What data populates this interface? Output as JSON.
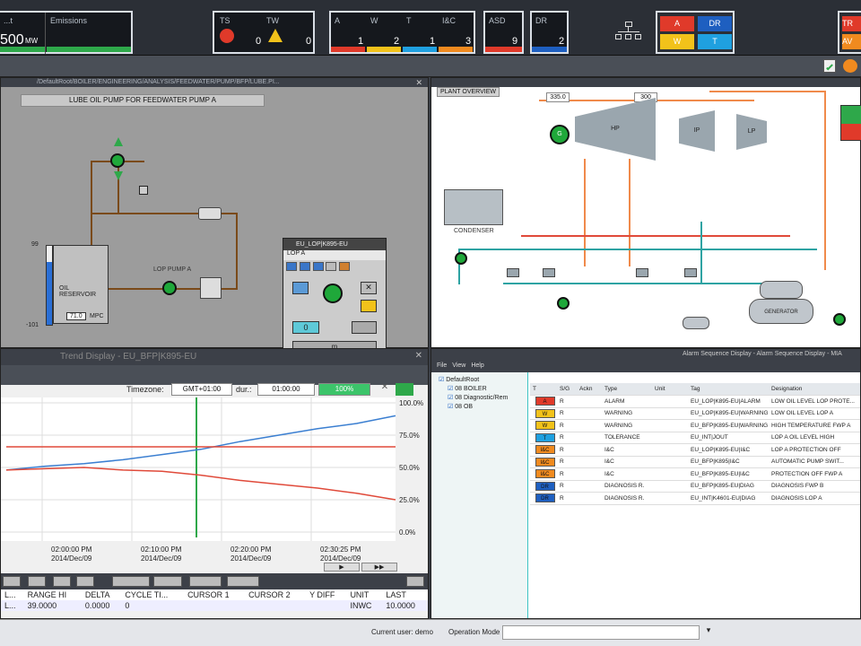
{
  "topbar": {
    "load": {
      "label": "...t",
      "value": "500",
      "unit": "MW"
    },
    "emissions": {
      "label": "Emissions"
    },
    "ts": {
      "label": "TS",
      "value": "0"
    },
    "tw": {
      "label": "TW",
      "value": "0"
    },
    "alarms": [
      {
        "label": "A",
        "value": "1",
        "color": "#e03a2a"
      },
      {
        "label": "W",
        "value": "2",
        "color": "#f2c21a"
      },
      {
        "label": "T",
        "value": "1",
        "color": "#1fa0e0"
      },
      {
        "label": "I&C",
        "value": "3",
        "color": "#f08a1f"
      }
    ],
    "asd": {
      "label": "ASD",
      "value": "9"
    },
    "dr": {
      "label": "DR",
      "value": "2"
    },
    "summary": [
      {
        "label": "A",
        "color": "#e03a2a"
      },
      {
        "label": "DR",
        "color": "#1e5fc0"
      },
      {
        "label": "W",
        "color": "#f2c21a"
      },
      {
        "label": "T",
        "color": "#1fa0e0"
      }
    ],
    "right": [
      {
        "label": "TR",
        "color": "#e03a2a"
      },
      {
        "label": "AV",
        "color": "#f08a1f"
      }
    ]
  },
  "lube": {
    "path": "/DefaultRoot/BOILER/ENGINEERING/ANALYSIS/FEEDWATER/PUMP/BFP/LUBE.PI...",
    "title": "LUBE OIL PUMP FOR FEEDWATER PUMP A",
    "tank_label": "OIL RESERVOIR",
    "tank_value": "71.0",
    "tank_unit": "MPC",
    "scale_top": "99",
    "scale_bottom": "-101",
    "pump_label": "LOP PUMP A",
    "faceplate": {
      "title": "EU_LOP|K895-EU",
      "subtitle": "LOP A",
      "value": "0",
      "button": "m"
    }
  },
  "plant": {
    "title": "PLANT OVERVIEW",
    "mw1": "335.0",
    "mw2": "300",
    "unit": "MW",
    "hp": "HP",
    "ip": "IP",
    "lp": "LP",
    "gen": "G",
    "condenser": "CONDENSER",
    "generator": "GENERATOR"
  },
  "trend": {
    "title": "Trend Display - EU_BFP|K895-EU",
    "timezone_label": "Timezone:",
    "timezone": "GMT+01:00",
    "dur_label": "dur.:",
    "dur": "01:00:00",
    "percent": "100%",
    "yaxis": [
      "100.0%",
      "75.0%",
      "50.0%",
      "25.0%",
      "0.0%"
    ],
    "xaxis": [
      {
        "t": "02:00:00 PM",
        "d": "2014/Dec/09"
      },
      {
        "t": "02:10:00 PM",
        "d": "2014/Dec/09"
      },
      {
        "t": "02:20:00 PM",
        "d": "2014/Dec/09"
      },
      {
        "t": "02:30:25 PM",
        "d": "2014/Dec/09"
      }
    ],
    "left_x": [
      "...0 PM",
      "...0"
    ],
    "table": {
      "headers": [
        "L...",
        "RANGE HI",
        "DELTA",
        "CYCLE TI...",
        "CURSOR 1",
        "CURSOR 2",
        "Y DIFF",
        "UNIT",
        "LAST"
      ],
      "values": [
        "L...",
        "39.0000",
        "0.0000",
        "0",
        "",
        "",
        "",
        "INWC",
        "10.0000"
      ]
    }
  },
  "chart_data": {
    "type": "line",
    "yticks": [
      "100.0%",
      "75.0%",
      "50.0%",
      "25.0%",
      "0.0%"
    ],
    "ylim": [
      0,
      100
    ],
    "xticks": [
      "02:00:00 PM",
      "02:10:00 PM",
      "02:20:00 PM",
      "02:30:25 PM"
    ],
    "series": [
      {
        "color": "#3b7fd1",
        "x": [
          0,
          0.1,
          0.2,
          0.3,
          0.4,
          0.5,
          0.6,
          0.7,
          0.8,
          0.9,
          1.0
        ],
        "values": [
          48,
          51,
          53,
          56,
          60,
          64,
          70,
          75,
          80,
          84,
          90
        ]
      },
      {
        "color": "#e04a3a",
        "x": [
          0,
          0.1,
          0.2,
          0.3,
          0.4,
          0.5,
          0.6,
          0.7,
          0.8,
          0.9,
          1.0
        ],
        "values": [
          48,
          49,
          50,
          48,
          47,
          44,
          40,
          37,
          34,
          30,
          25
        ]
      },
      {
        "color": "#e04a3a",
        "x": [
          0,
          1
        ],
        "values": [
          66,
          66
        ]
      }
    ]
  },
  "alarmdisp": {
    "title": "Alarm Sequence Display - Alarm Sequence Display - MIA",
    "menu": [
      "File",
      "View",
      "Help"
    ],
    "tree": [
      "DefaultRoot",
      "08 BOILER",
      "08 Diagnostic/Rem",
      "08 OB"
    ],
    "headers": [
      "T",
      "S/G",
      "Ackn",
      "Type",
      "Unit",
      "Tag",
      "Designation"
    ],
    "rows": [
      {
        "sev": "A",
        "sevc": "#e03a2a",
        "sg": "R",
        "type": "ALARM",
        "tag": "EU_LOP|K895-EU|ALARM",
        "des": "LOW OIL LEVEL LOP PROTE..."
      },
      {
        "sev": "W",
        "sevc": "#f2c21a",
        "sg": "R",
        "type": "WARNING",
        "tag": "EU_LOP|K895-EU|WARNING",
        "des": "LOW OIL LEVEL LOP A"
      },
      {
        "sev": "W",
        "sevc": "#f2c21a",
        "sg": "R",
        "type": "WARNING",
        "tag": "EU_BFP|K895-EU|WARNING",
        "des": "HIGH TEMPERATURE FWP A"
      },
      {
        "sev": "T",
        "sevc": "#1fa0e0",
        "sg": "R",
        "type": "TOLERANCE",
        "tag": "EU_INT|JOUT",
        "des": "LOP A OIL LEVEL HIGH"
      },
      {
        "sev": "I&C",
        "sevc": "#f08a1f",
        "sg": "R",
        "type": "I&C",
        "tag": "EU_LOP|K895-EU|I&C",
        "des": "LOP A PROTECTION OFF"
      },
      {
        "sev": "I&C",
        "sevc": "#f08a1f",
        "sg": "R",
        "type": "I&C",
        "tag": "EU_BFP|K895|I&C",
        "des": "AUTOMATIC PUMP SWIT..."
      },
      {
        "sev": "I&C",
        "sevc": "#f08a1f",
        "sg": "R",
        "type": "I&C",
        "tag": "EU_BFP|K895-EU|I&C",
        "des": "PROTECTION OFF FWP A"
      },
      {
        "sev": "DR",
        "sevc": "#1e5fc0",
        "sg": "R",
        "type": "DIAGNOSIS R.",
        "tag": "EU_BFP|K895-EU|DIAG",
        "des": "DIAGNOSIS FWP B"
      },
      {
        "sev": "DR",
        "sevc": "#1e5fc0",
        "sg": "R",
        "type": "DIAGNOSIS R.",
        "tag": "EU_INT|K4601-EU|DIAG",
        "des": "DIAGNOSIS LOP A"
      }
    ]
  },
  "status": {
    "user": "Current user: demo",
    "mode": "Operation Mode"
  }
}
